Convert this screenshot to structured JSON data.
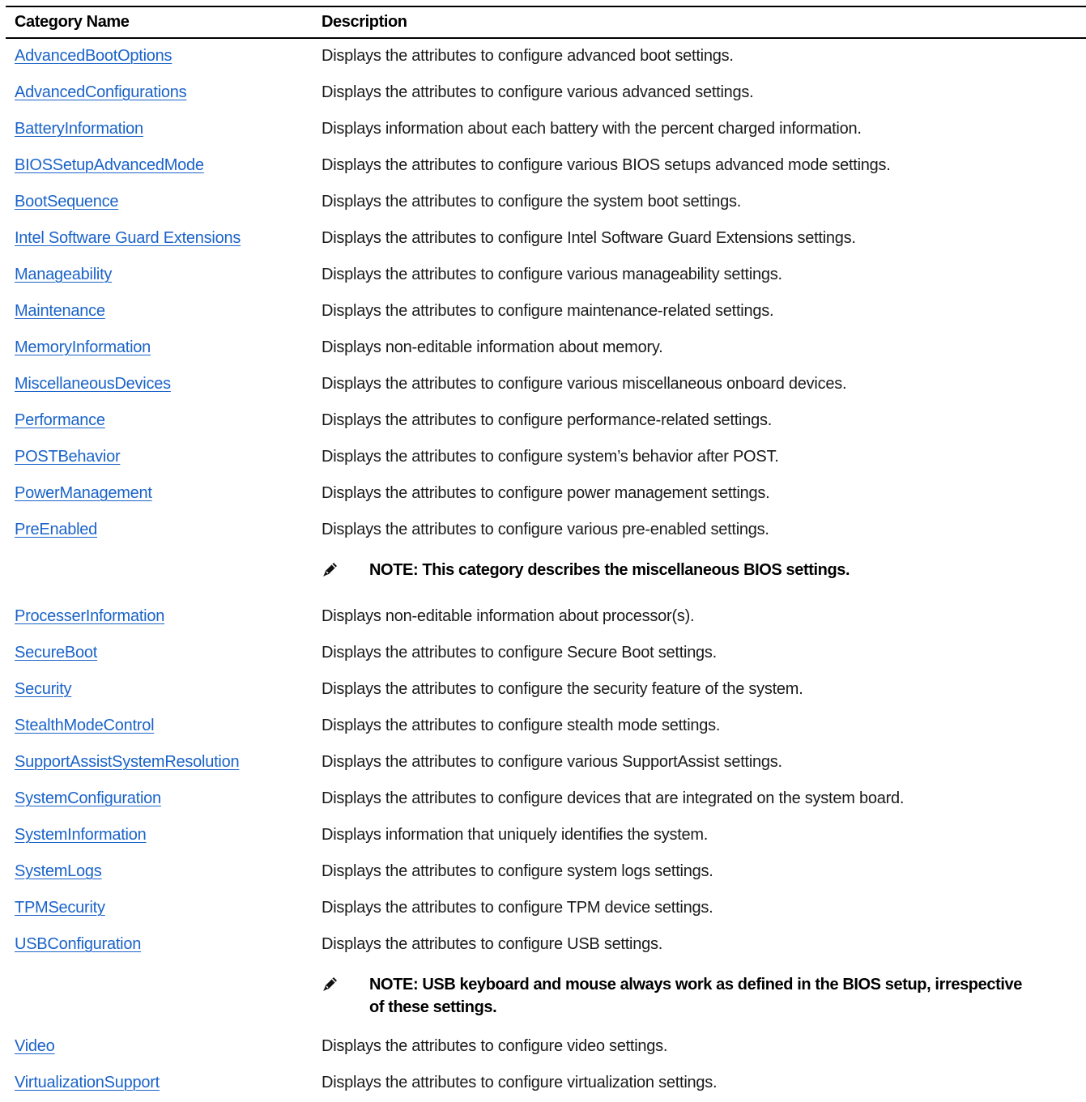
{
  "table": {
    "headers": {
      "category": "Category Name",
      "description": "Description"
    },
    "rows": [
      {
        "name": "AdvancedBootOptions",
        "description": "Displays the attributes to configure advanced boot settings."
      },
      {
        "name": "AdvancedConfigurations",
        "description": "Displays the attributes to configure various advanced settings."
      },
      {
        "name": "BatteryInformation",
        "description": "Displays information about each battery with the percent charged information."
      },
      {
        "name": "BIOSSetupAdvancedMode",
        "description": "Displays the attributes to configure various BIOS setups advanced mode settings."
      },
      {
        "name": "BootSequence",
        "description": "Displays the attributes to configure the system boot settings."
      },
      {
        "name": "Intel Software Guard Extensions",
        "description": "Displays the attributes to configure Intel Software Guard Extensions settings."
      },
      {
        "name": "Manageability",
        "description": "Displays the attributes to configure various manageability settings."
      },
      {
        "name": "Maintenance",
        "description": "Displays the attributes to configure maintenance-related settings."
      },
      {
        "name": "MemoryInformation",
        "description": "Displays non-editable information about memory."
      },
      {
        "name": "MiscellaneousDevices",
        "description": "Displays the attributes to configure various miscellaneous onboard devices."
      },
      {
        "name": "Performance",
        "description": "Displays the attributes to configure performance-related settings."
      },
      {
        "name": "POSTBehavior",
        "description": "Displays the attributes to configure system’s behavior after POST."
      },
      {
        "name": "PowerManagement",
        "description": "Displays the attributes to configure power management settings."
      },
      {
        "name": "PreEnabled",
        "description": "Displays the attributes to configure various pre-enabled settings.",
        "note": "NOTE: This category describes the miscellaneous BIOS settings."
      },
      {
        "name": "ProcesserInformation",
        "description": "Displays non-editable information about processor(s)."
      },
      {
        "name": "SecureBoot",
        "description": "Displays the attributes to configure Secure Boot settings."
      },
      {
        "name": "Security",
        "description": "Displays the attributes to configure the security feature of the system."
      },
      {
        "name": "StealthModeControl",
        "description": "Displays the attributes to configure stealth mode settings."
      },
      {
        "name": "SupportAssistSystemResolution",
        "description": "Displays the attributes to configure various SupportAssist settings."
      },
      {
        "name": "SystemConfiguration",
        "description": "Displays the attributes to configure devices that are integrated on the system board."
      },
      {
        "name": "SystemInformation",
        "description": "Displays information that uniquely identifies the system."
      },
      {
        "name": "SystemLogs",
        "description": "Displays the attributes to configure system logs settings."
      },
      {
        "name": "TPMSecurity",
        "description": "Displays the attributes to configure TPM device settings."
      },
      {
        "name": "USBConfiguration",
        "description": "Displays the attributes to configure USB settings.",
        "note": "NOTE: USB keyboard and mouse always work as defined in the BIOS setup, irrespective of these settings."
      },
      {
        "name": "Video",
        "description": "Displays the attributes to configure video settings."
      },
      {
        "name": "VirtualizationSupport",
        "description": "Displays the attributes to configure virtualization settings."
      }
    ]
  },
  "icons": {
    "note": "pencil-note-icon"
  },
  "colors": {
    "link": "#1a63c9",
    "text": "#1a1a1a",
    "rule": "#000000"
  }
}
